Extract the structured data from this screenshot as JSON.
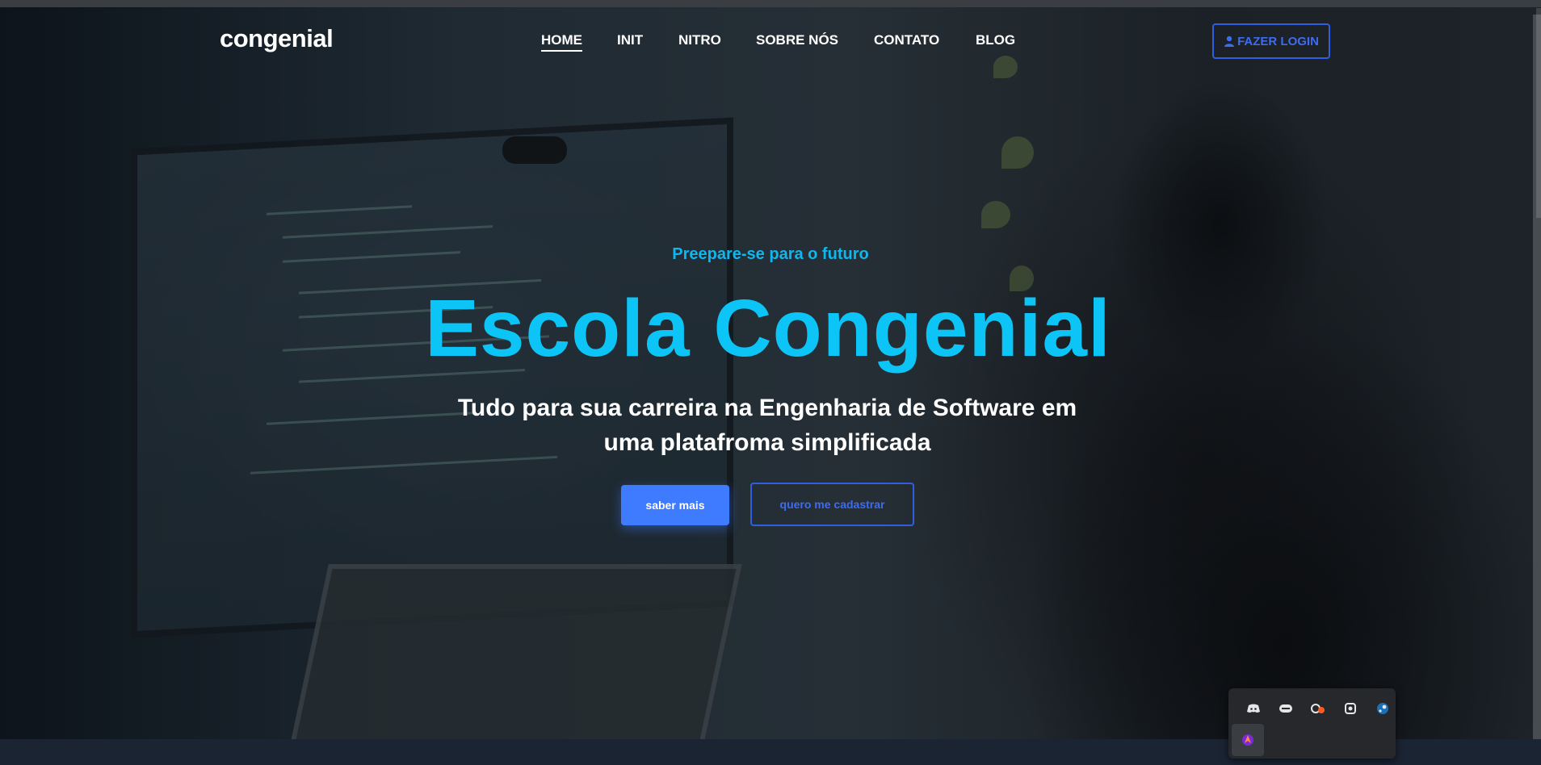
{
  "header": {
    "logo": "congenial",
    "nav": [
      {
        "label": "HOME",
        "active": true
      },
      {
        "label": "INIT",
        "active": false
      },
      {
        "label": "NITRO",
        "active": false
      },
      {
        "label": "SOBRE NÓS",
        "active": false
      },
      {
        "label": "CONTATO",
        "active": false
      },
      {
        "label": "BLOG",
        "active": false
      }
    ],
    "login_label": "FAZER LOGIN",
    "login_icon": "user-icon"
  },
  "hero": {
    "eyebrow": "Preepare-se para o futuro",
    "title": "Escola Congenial",
    "subtitle_line1": "Tudo para sua carreira na Engenharia de Software em",
    "subtitle_line2": "uma platafroma simplificada",
    "primary_button": "saber mais",
    "secondary_button": "quero me cadastrar"
  },
  "tray": {
    "icons": [
      "discord-icon",
      "nvidia-icon",
      "origin-icon",
      "openvpn-icon",
      "steam-icon",
      "launcher-icon"
    ]
  },
  "colors": {
    "accent": "#0cc4f5",
    "button_blue": "#3e7bff",
    "outline_blue": "#2f5fe0"
  }
}
